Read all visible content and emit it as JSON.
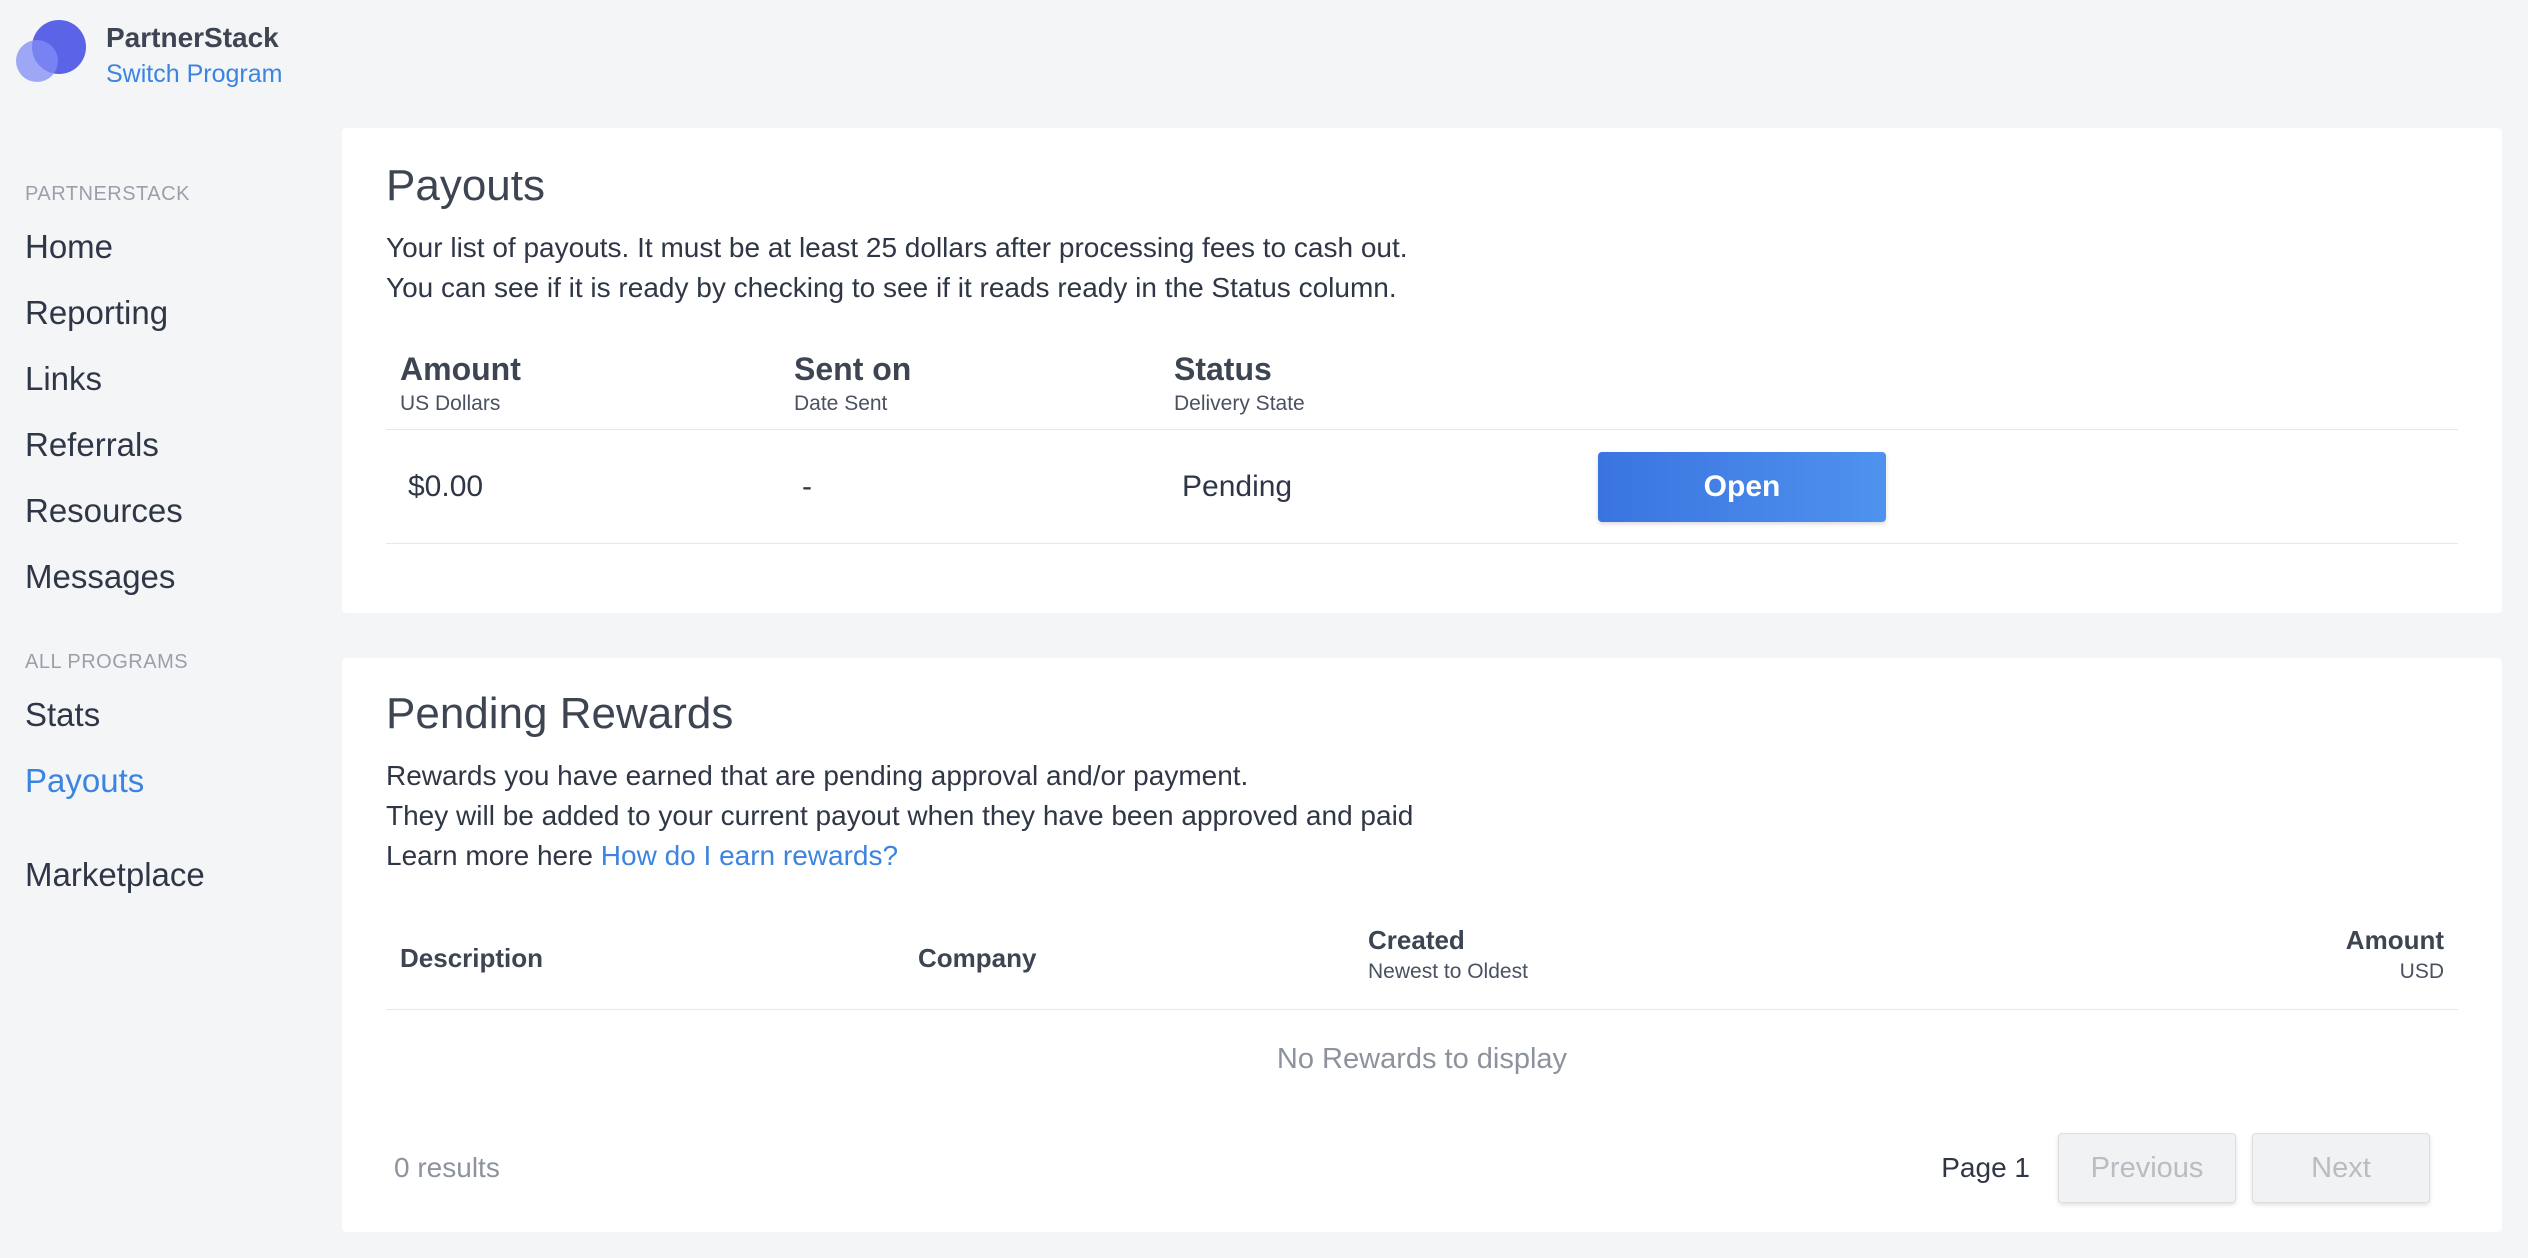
{
  "brand": {
    "name": "PartnerStack",
    "switch_label": "Switch Program"
  },
  "sidebar": {
    "group1_heading": "PARTNERSTACK",
    "group1_items": [
      "Home",
      "Reporting",
      "Links",
      "Referrals",
      "Resources",
      "Messages"
    ],
    "group2_heading": "ALL PROGRAMS",
    "group2_items": [
      "Stats",
      "Payouts"
    ],
    "active_item": "Payouts",
    "marketplace": "Marketplace"
  },
  "payouts": {
    "title": "Payouts",
    "desc_line1": "Your list of payouts. It must be at least 25 dollars after processing fees to cash out.",
    "desc_line2": "You can see if it is ready by checking to see if it reads ready in the Status column.",
    "columns": [
      {
        "title": "Amount",
        "subtitle": "US Dollars"
      },
      {
        "title": "Sent on",
        "subtitle": "Date Sent"
      },
      {
        "title": "Status",
        "subtitle": "Delivery State"
      }
    ],
    "row": {
      "amount": "$0.00",
      "sent_on": "-",
      "status": "Pending",
      "action_label": "Open"
    }
  },
  "rewards": {
    "title": "Pending Rewards",
    "desc_line1": "Rewards you have earned that are pending approval and/or payment.",
    "desc_line2": "They will be added to your current payout when they have been approved and paid",
    "learn_prefix": "Learn more here ",
    "learn_link": "How do I earn rewards?",
    "columns": {
      "description": "Description",
      "company": "Company",
      "created": "Created",
      "created_sub": "Newest to Oldest",
      "amount": "Amount",
      "amount_sub": "USD"
    },
    "empty_text": "No Rewards to display",
    "results": "0 results",
    "page_label": "Page 1",
    "prev_label": "Previous",
    "next_label": "Next"
  },
  "colors": {
    "accent": "#3b84e0",
    "logo": "#5b63e6",
    "button": "#3a74e0"
  }
}
